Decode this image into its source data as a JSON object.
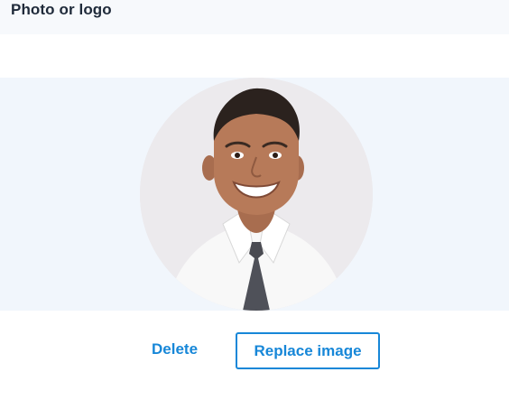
{
  "header": {
    "title": "Photo or logo"
  },
  "preview": {
    "image_subject": "portrait-photo",
    "background_color": "#f1f6fc"
  },
  "actions": {
    "delete_label": "Delete",
    "replace_label": "Replace image"
  },
  "colors": {
    "accent": "#1787d8",
    "text": "#1f2a3a"
  }
}
